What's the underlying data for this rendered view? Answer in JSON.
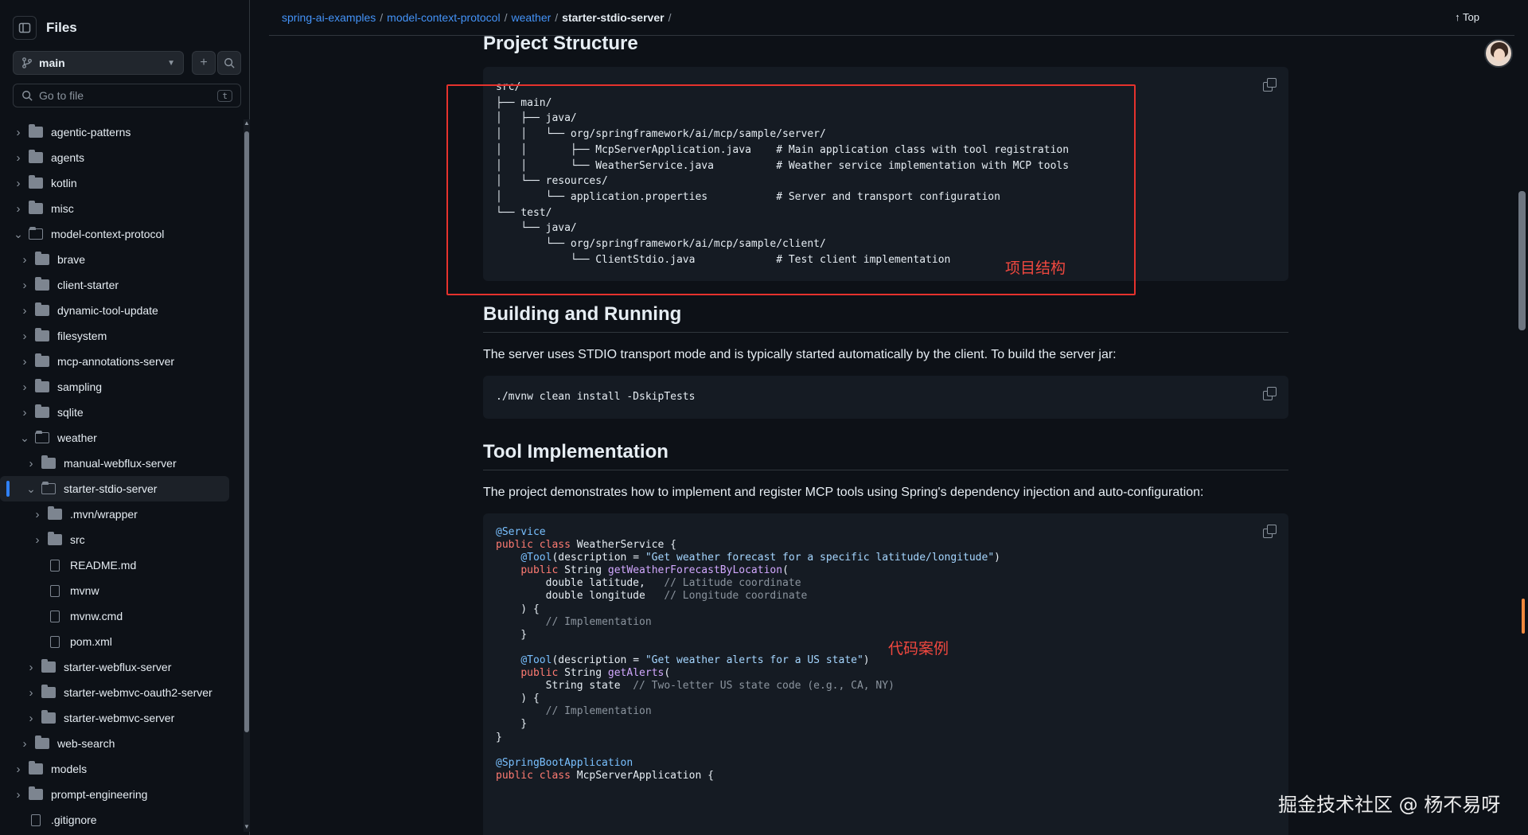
{
  "sidebar": {
    "title": "Files",
    "branch": "main",
    "search_placeholder": "Go to file",
    "search_shortcut": "t",
    "tree": [
      {
        "label": "agentic-patterns",
        "type": "folder",
        "depth": 0,
        "expanded": false
      },
      {
        "label": "agents",
        "type": "folder",
        "depth": 0,
        "expanded": false
      },
      {
        "label": "kotlin",
        "type": "folder",
        "depth": 0,
        "expanded": false
      },
      {
        "label": "misc",
        "type": "folder",
        "depth": 0,
        "expanded": false
      },
      {
        "label": "model-context-protocol",
        "type": "folder",
        "depth": 0,
        "expanded": true
      },
      {
        "label": "brave",
        "type": "folder",
        "depth": 1,
        "expanded": false
      },
      {
        "label": "client-starter",
        "type": "folder",
        "depth": 1,
        "expanded": false
      },
      {
        "label": "dynamic-tool-update",
        "type": "folder",
        "depth": 1,
        "expanded": false
      },
      {
        "label": "filesystem",
        "type": "folder",
        "depth": 1,
        "expanded": false
      },
      {
        "label": "mcp-annotations-server",
        "type": "folder",
        "depth": 1,
        "expanded": false
      },
      {
        "label": "sampling",
        "type": "folder",
        "depth": 1,
        "expanded": false
      },
      {
        "label": "sqlite",
        "type": "folder",
        "depth": 1,
        "expanded": false
      },
      {
        "label": "weather",
        "type": "folder",
        "depth": 1,
        "expanded": true
      },
      {
        "label": "manual-webflux-server",
        "type": "folder",
        "depth": 2,
        "expanded": false
      },
      {
        "label": "starter-stdio-server",
        "type": "folder",
        "depth": 2,
        "expanded": true,
        "selected": true
      },
      {
        "label": ".mvn/wrapper",
        "type": "folder",
        "depth": 3,
        "expanded": false
      },
      {
        "label": "src",
        "type": "folder",
        "depth": 3,
        "expanded": false
      },
      {
        "label": "README.md",
        "type": "file",
        "depth": 3
      },
      {
        "label": "mvnw",
        "type": "file",
        "depth": 3
      },
      {
        "label": "mvnw.cmd",
        "type": "file",
        "depth": 3
      },
      {
        "label": "pom.xml",
        "type": "file",
        "depth": 3
      },
      {
        "label": "starter-webflux-server",
        "type": "folder",
        "depth": 2,
        "expanded": false
      },
      {
        "label": "starter-webmvc-oauth2-server",
        "type": "folder",
        "depth": 2,
        "expanded": false
      },
      {
        "label": "starter-webmvc-server",
        "type": "folder",
        "depth": 2,
        "expanded": false
      },
      {
        "label": "web-search",
        "type": "folder",
        "depth": 1,
        "expanded": false
      },
      {
        "label": "models",
        "type": "folder",
        "depth": 0,
        "expanded": false
      },
      {
        "label": "prompt-engineering",
        "type": "folder",
        "depth": 0,
        "expanded": false
      },
      {
        "label": ".gitignore",
        "type": "file",
        "depth": 0
      }
    ]
  },
  "breadcrumb": {
    "links": [
      "spring-ai-examples",
      "model-context-protocol",
      "weather"
    ],
    "current": "starter-stdio-server",
    "trailing_sep": "/",
    "top_label": "Top"
  },
  "content": {
    "h_structure": "Project Structure",
    "structure_code": "src/\n├── main/\n│   ├── java/\n│   │   └── org/springframework/ai/mcp/sample/server/\n│   │       ├── McpServerApplication.java    # Main application class with tool registration\n│   │       └── WeatherService.java          # Weather service implementation with MCP tools\n│   └── resources/\n│       └── application.properties           # Server and transport configuration\n└── test/\n    └── java/\n        └── org/springframework/ai/mcp/sample/client/\n            └── ClientStdio.java             # Test client implementation",
    "h_building": "Building and Running",
    "p_building": "The server uses STDIO transport mode and is typically started automatically by the client. To build the server jar:",
    "build_cmd": "./mvnw clean install -DskipTests",
    "h_tool": "Tool Implementation",
    "p_tool": "The project demonstrates how to implement and register MCP tools using Spring's dependency injection and auto-configuration:",
    "java_lines": [
      [
        {
          "t": "an",
          "v": "@Service"
        }
      ],
      [
        {
          "t": "kw",
          "v": "public class"
        },
        {
          "t": "",
          "v": " WeatherService {"
        }
      ],
      [
        {
          "t": "",
          "v": "    "
        },
        {
          "t": "an",
          "v": "@Tool"
        },
        {
          "t": "",
          "v": "(description = "
        },
        {
          "t": "str",
          "v": "\"Get weather forecast for a specific latitude/longitude\""
        },
        {
          "t": "",
          "v": ")"
        }
      ],
      [
        {
          "t": "",
          "v": "    "
        },
        {
          "t": "kw",
          "v": "public"
        },
        {
          "t": "",
          "v": " String "
        },
        {
          "t": "fn",
          "v": "getWeatherForecastByLocation"
        },
        {
          "t": "",
          "v": "("
        }
      ],
      [
        {
          "t": "",
          "v": "        double latitude,   "
        },
        {
          "t": "cm",
          "v": "// Latitude coordinate"
        }
      ],
      [
        {
          "t": "",
          "v": "        double longitude   "
        },
        {
          "t": "cm",
          "v": "// Longitude coordinate"
        }
      ],
      [
        {
          "t": "",
          "v": "    ) {"
        }
      ],
      [
        {
          "t": "",
          "v": "        "
        },
        {
          "t": "cm",
          "v": "// Implementation"
        }
      ],
      [
        {
          "t": "",
          "v": "    }"
        }
      ],
      [
        {
          "t": "",
          "v": ""
        }
      ],
      [
        {
          "t": "",
          "v": "    "
        },
        {
          "t": "an",
          "v": "@Tool"
        },
        {
          "t": "",
          "v": "(description = "
        },
        {
          "t": "str",
          "v": "\"Get weather alerts for a US state\""
        },
        {
          "t": "",
          "v": ")"
        }
      ],
      [
        {
          "t": "",
          "v": "    "
        },
        {
          "t": "kw",
          "v": "public"
        },
        {
          "t": "",
          "v": " String "
        },
        {
          "t": "fn",
          "v": "getAlerts"
        },
        {
          "t": "",
          "v": "("
        }
      ],
      [
        {
          "t": "",
          "v": "        String state  "
        },
        {
          "t": "cm",
          "v": "// Two-letter US state code (e.g., CA, NY)"
        }
      ],
      [
        {
          "t": "",
          "v": "    ) {"
        }
      ],
      [
        {
          "t": "",
          "v": "        "
        },
        {
          "t": "cm",
          "v": "// Implementation"
        }
      ],
      [
        {
          "t": "",
          "v": "    }"
        }
      ],
      [
        {
          "t": "",
          "v": "}"
        }
      ],
      [
        {
          "t": "",
          "v": ""
        }
      ],
      [
        {
          "t": "an",
          "v": "@SpringBootApplication"
        }
      ],
      [
        {
          "t": "kw",
          "v": "public class"
        },
        {
          "t": "",
          "v": " McpServerApplication {"
        }
      ]
    ]
  },
  "annotations": {
    "structure_note": "项目结构",
    "code_note": "代码案例",
    "watermark": "掘金技术社区 @ 杨不易呀"
  },
  "colors": {
    "accent": "#4493f8",
    "highlight_box": "#e5322d",
    "background": "#0d1117"
  }
}
